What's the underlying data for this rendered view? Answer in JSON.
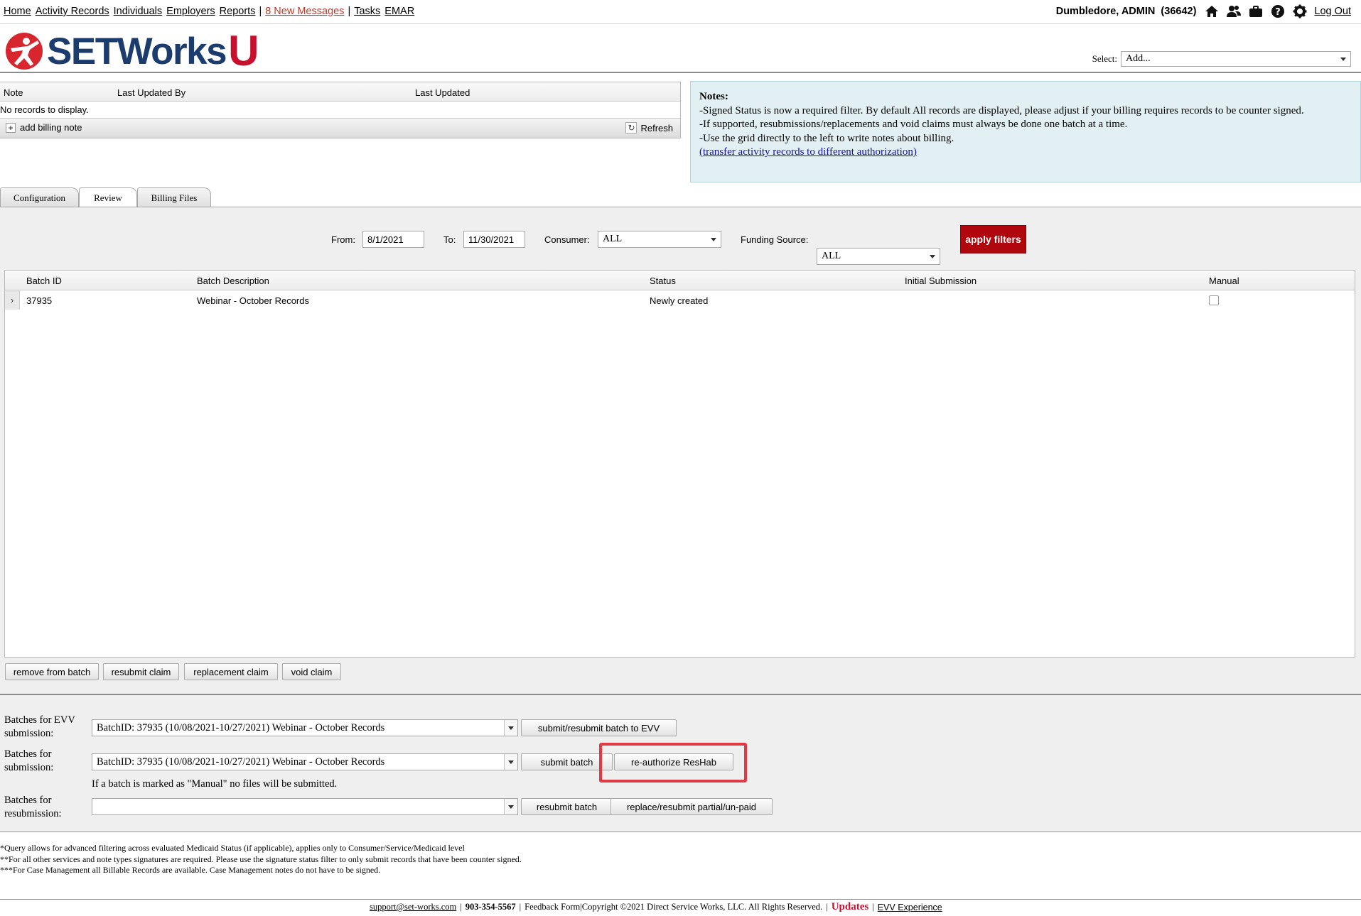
{
  "topnav": {
    "items": [
      "Home",
      "Activity Records",
      "Individuals",
      "Employers",
      "Reports"
    ],
    "messages": "8 New Messages",
    "items2": [
      "Tasks",
      "EMAR"
    ]
  },
  "user": {
    "name": "Dumbledore, ADMIN",
    "id": "(36642)",
    "logout": "Log Out"
  },
  "logo": {
    "text": "SETWorks",
    "u": "U"
  },
  "select": {
    "label": "Select:",
    "value": "Add..."
  },
  "notes_grid": {
    "columns": [
      "Note",
      "Last Updated By",
      "Last Updated"
    ],
    "empty": "No records to display.",
    "add": "add billing note",
    "refresh": "Refresh"
  },
  "notes_box": {
    "title": "Notes:",
    "lines": [
      "-Signed Status is now a required filter. By default All records are displayed, please adjust if your billing requires records to be counter signed.",
      "-If supported, resubmissions/replacements and void claims must always be done one batch at a time.",
      "-Use the grid directly to the left to write notes about billing."
    ],
    "link": "(transfer activity records to different authorization)"
  },
  "tabs": [
    "Configuration",
    "Review",
    "Billing Files"
  ],
  "filters": {
    "from_label": "From:",
    "from": "8/1/2021",
    "to_label": "To:",
    "to": "11/30/2021",
    "consumer_label": "Consumer:",
    "consumer": "ALL",
    "funding_label": "Funding Source:",
    "funding": "ALL",
    "apply": "apply filters"
  },
  "batch_grid": {
    "columns": [
      "Batch ID",
      "Batch Description",
      "Status",
      "Initial Submission",
      "Manual"
    ],
    "rows": [
      {
        "id": "37935",
        "description": "Webinar - October Records",
        "status": "Newly created",
        "initial": "",
        "manual": false
      }
    ]
  },
  "grid_buttons": [
    "remove from batch",
    "resubmit claim",
    "replacement claim",
    "void claim"
  ],
  "submission": {
    "evv_label": "Batches for EVV submission:",
    "evv_value": "BatchID: 37935 (10/08/2021-10/27/2021) Webinar - October Records",
    "evv_button": "submit/resubmit batch to EVV",
    "sub_label": "Batches for submission:",
    "sub_value": "BatchID: 37935 (10/08/2021-10/27/2021) Webinar - October Records",
    "sub_button": "submit batch",
    "reauth_button": "re-authorize ResHab",
    "manual_note": "If a batch is marked as \"Manual\" no files will be submitted.",
    "resub_label": "Batches for resubmission:",
    "resub_value": "",
    "resub_button": "resubmit batch",
    "replace_button": "replace/resubmit partial/un-paid"
  },
  "footnotes": [
    "*Query allows for advanced filtering across evaluated Medicaid Status (if applicable), applies only to Consumer/Service/Medicaid level",
    "**For all other services and note types signatures are required. Please use the signature status filter to only submit records that have been counter signed.",
    "***For Case Management all Billable Records are available. Case Management notes do not have to be signed."
  ],
  "footer": {
    "email": "support@set-works.com",
    "phone": "903-354-5567",
    "text": "Feedback Form|Copyright ©2021 Direct Service Works, LLC. All Rights Reserved.",
    "updates": "Updates",
    "evv": "EVV Experience"
  },
  "colors": {
    "brand_red": "#c8102e",
    "brand_navy": "#1d3c6e",
    "apply_red": "#b0060e",
    "highlight": "#e03a45",
    "notes_bg": "#e2f0f3"
  }
}
